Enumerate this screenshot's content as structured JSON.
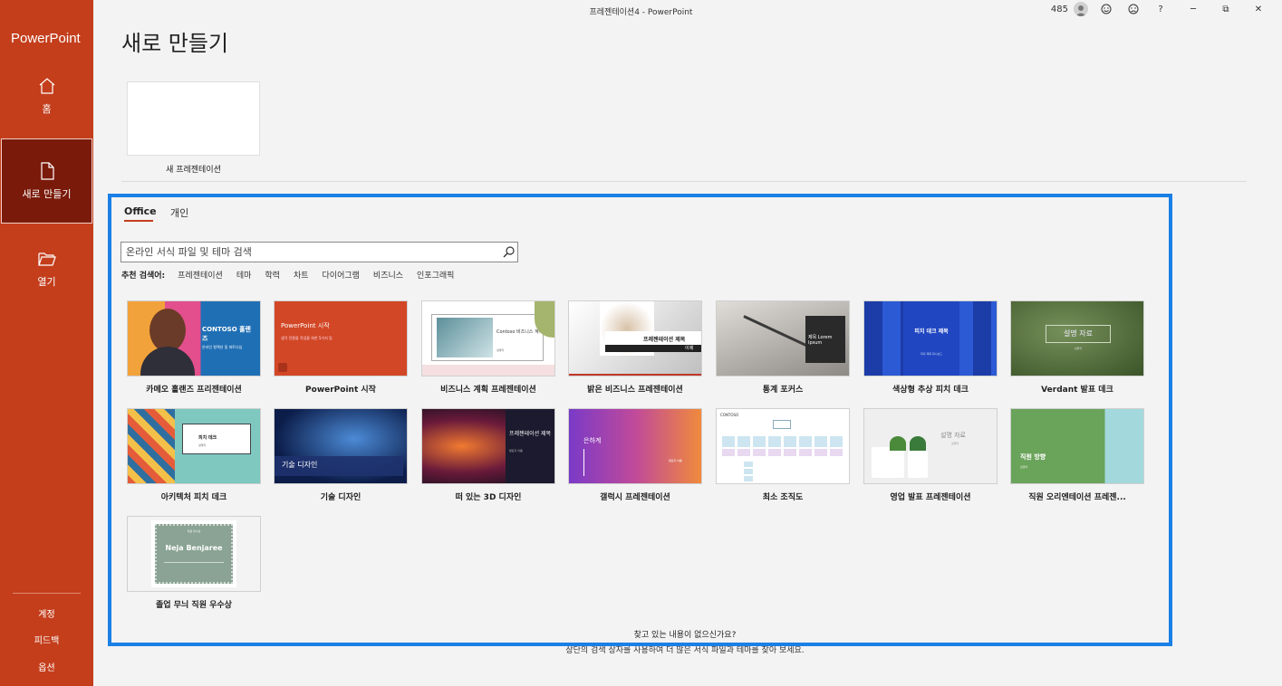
{
  "window": {
    "title": "프레젠테이션4  -  PowerPoint",
    "count": "485",
    "minimize": "─",
    "restore": "⧉",
    "close": "✕",
    "help": "?"
  },
  "sidebar": {
    "app_name": "PowerPoint",
    "home": "홈",
    "new": "새로 만들기",
    "open": "열기",
    "account": "계정",
    "feedback": "피드백",
    "options": "옵션"
  },
  "main": {
    "title": "새로 만들기",
    "blank_label": "새 프레젠테이션",
    "tabs": [
      "Office",
      "개인"
    ],
    "search_placeholder": "온라인 서식 파일 및 테마 검색",
    "suggest_label": "추천 검색어:",
    "suggestions": [
      "프레젠테이션",
      "테마",
      "학력",
      "차트",
      "다이어그램",
      "비즈니스",
      "인포그래픽"
    ],
    "help_title": "찾고 있는 내용이 없으신가요?",
    "help_sub": "상단의 검색 상자를 사용하여 더 많은 서식 파일과 테마를 찾아 보세요."
  },
  "templates": [
    {
      "name": "카메오 홀랜즈 프리젠테이션",
      "thumb_text": "CONTOSO 홀랜즈",
      "thumb_sub": "온라인 컬렉션 및 파트너십",
      "colors": [
        "#e8a13a",
        "#1f6fb5"
      ]
    },
    {
      "name": "PowerPoint 시작",
      "thumb_text": "PowerPoint 시작",
      "thumb_sub": "생각 전환을 작업을 위한 5가지 팁",
      "colors": [
        "#d24726"
      ]
    },
    {
      "name": "비즈니스 계획 프레젠테이션",
      "thumb_text": "Contoso 비즈니스 계획",
      "thumb_sub": "설명자",
      "colors": [
        "#f4d9dc"
      ]
    },
    {
      "name": "밝은 비즈니스 프레젠테이션",
      "thumb_text": "프레젠테이션 제목",
      "thumb_sub": "이제",
      "colors": [
        "#e8e8e8"
      ]
    },
    {
      "name": "통계 포커스",
      "thumb_text": "제목 Lorem Ipsum",
      "thumb_sub": "",
      "colors": [
        "#2a2a2a"
      ]
    },
    {
      "name": "색상형 추상 피치 데크",
      "thumb_text": "피치 데크 제목",
      "thumb_sub": "회의 제목 대시보드",
      "colors": [
        "#1a3fa8"
      ]
    },
    {
      "name": "Verdant 발표 데크",
      "thumb_text": "설명 자료",
      "thumb_sub": "설명자",
      "colors": [
        "#4d6b3a"
      ]
    },
    {
      "name": "아키텍처 피치 데크",
      "thumb_text": "피치 데크",
      "thumb_sub": "설명자",
      "colors": [
        "#7ec8c0"
      ]
    },
    {
      "name": "기술 디자인",
      "thumb_text": "기술 디자인",
      "thumb_sub": "",
      "colors": [
        "#12295c"
      ]
    },
    {
      "name": "떠 있는 3D 디자인",
      "thumb_text": "프레젠테이션 제목",
      "thumb_sub": "발표자 이름",
      "colors": [
        "#5a1a2a"
      ]
    },
    {
      "name": "갤럭시 프레젠테이션",
      "thumb_text": "은하계",
      "thumb_sub": "발표자 이름",
      "colors": [
        "#7a3ac8",
        "#f08a3c"
      ]
    },
    {
      "name": "최소 조직도",
      "thumb_text": "CONTOSO",
      "thumb_sub": "",
      "colors": [
        "#ffffff"
      ]
    },
    {
      "name": "영업 발표 프레젠테이션",
      "thumb_text": "설명 자료",
      "thumb_sub": "설명자",
      "colors": [
        "#efefef"
      ]
    },
    {
      "name": "직원 오리엔테이션 프레젠...",
      "thumb_text": "직원 방향",
      "thumb_sub": "설명자",
      "colors": [
        "#6aa35a",
        "#a3d9dc"
      ]
    },
    {
      "name": "졸업 무늬 직원 우수상",
      "thumb_text": "Neja Benjaree",
      "thumb_sub": "직원 우수상",
      "colors": [
        "#8aa394"
      ]
    }
  ]
}
